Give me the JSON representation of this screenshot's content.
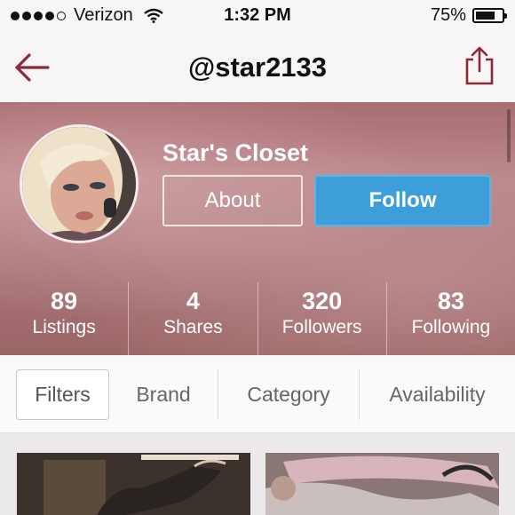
{
  "status_bar": {
    "carrier": "Verizon",
    "time": "1:32 PM",
    "battery_percent": "75%",
    "battery_level": 0.75,
    "signal_bars_filled": 4,
    "signal_bars_total": 5
  },
  "nav": {
    "title": "@star2133",
    "back_icon": "back-arrow-icon",
    "share_icon": "share-icon",
    "accent_color": "#8b2b3a"
  },
  "profile": {
    "closet_name": "Star's Closet",
    "about_label": "About",
    "follow_label": "Follow",
    "follow_color": "#3d9fd9",
    "stats": [
      {
        "value": "89",
        "label": "Listings"
      },
      {
        "value": "4",
        "label": "Shares"
      },
      {
        "value": "320",
        "label": "Followers"
      },
      {
        "value": "83",
        "label": "Following"
      }
    ]
  },
  "filters": {
    "filter_label": "Filters",
    "tabs": [
      "Brand",
      "Category",
      "Availability"
    ]
  }
}
